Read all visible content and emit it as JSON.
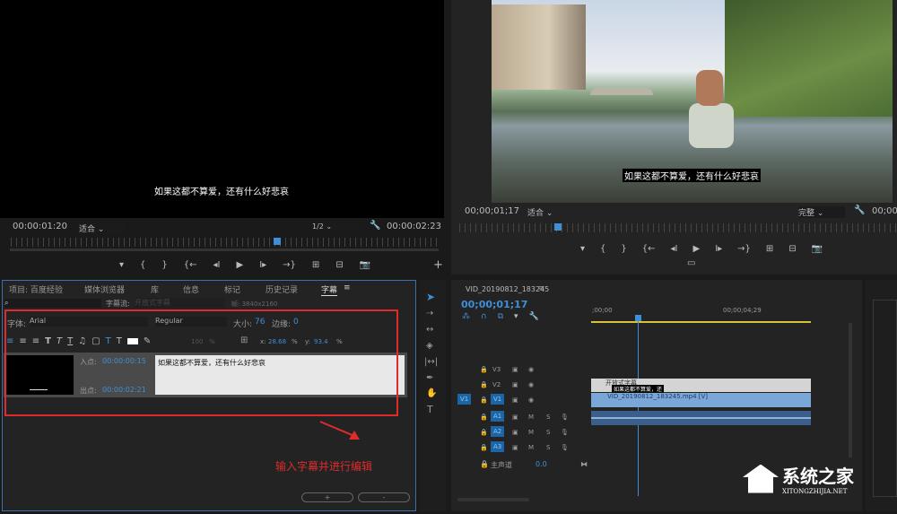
{
  "source_monitor": {
    "subtitle": "如果这都不算爱，还有什么好悲哀",
    "timecode": "00:00:01:20",
    "fit": "适合",
    "resolution": "1/2",
    "duration": "00:00:02:23"
  },
  "program_monitor": {
    "subtitle": "如果这都不算爱，还有什么好悲哀",
    "timecode": "00;00;01;17",
    "fit": "适合",
    "quality": "完整",
    "duration": "00;00;"
  },
  "transport": {
    "marker": "▾",
    "in": "{",
    "out": "}",
    "go_in": "{←",
    "step_back": "◂I",
    "play": "▶",
    "step_fwd": "I▸",
    "go_out": "→}",
    "insert": "⊞",
    "overwrite": "⊟",
    "export_frame": "📷",
    "add": "+",
    "compare": "▭"
  },
  "caption_panel": {
    "tabs": [
      "项目: 百度经验",
      "媒体浏览器",
      "库",
      "信息",
      "标记",
      "历史记录",
      "字幕"
    ],
    "menu": "≡",
    "stream_label": "字幕流:",
    "stream_value": "开放式字幕",
    "frame_label": "帧: 3840x2160",
    "font_label": "字体:",
    "font": "Arial",
    "style": "Regular",
    "size_label": "大小:",
    "size": "76",
    "edge_label": "边缘:",
    "edge": "0",
    "opacity": "100",
    "pct": "%",
    "x_label": "x:",
    "x": "28.68",
    "y_label": "y:",
    "y": "93.4",
    "in_label": "入点:",
    "in_time": "00:00:00:15",
    "out_label": "出点:",
    "out_time": "00:00:02:21",
    "caption_text": "如果这都不算爱，还有什么好悲哀",
    "add": "+",
    "remove": "-"
  },
  "annotation": "输入字幕并进行编辑",
  "timeline": {
    "sequence": "VID_20190812_183245",
    "menu": "≡",
    "timecode": "00;00;01;17",
    "ruler": [
      ";00;00",
      "00;00;04;29"
    ],
    "video_tracks": [
      "V3",
      "V2",
      "V1"
    ],
    "source_patch_v": "V1",
    "audio_tracks": [
      "A1",
      "A2",
      "A3"
    ],
    "mute": "M",
    "solo": "S",
    "master_label": "主声道",
    "master_value": "0.0",
    "caption_clip": "开放式字幕",
    "caption_clip_text": "如果这都不算爱，还",
    "video_clip": "VID_20190812_183245.mp4 [V]"
  },
  "watermark": {
    "text": "系统之家",
    "url_text": "XITONGZHIJIA.NET"
  },
  "colors": {
    "accent": "#3f8fd8",
    "highlight": "#e02b2b",
    "clip_video": "#7aa7d8",
    "clip_caption": "#d4d4d4",
    "audio": "#3b5e8a"
  }
}
